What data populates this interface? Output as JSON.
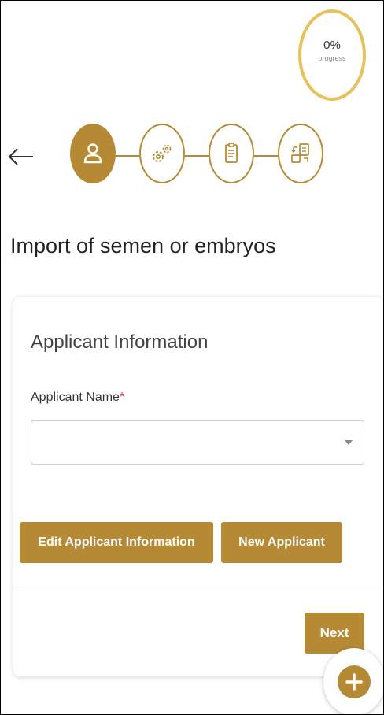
{
  "progress": {
    "value": "0%",
    "label": "progress",
    "fraction": 0
  },
  "nav": {
    "back_icon": "arrow-left-icon"
  },
  "stepper": {
    "active_index": 0,
    "steps": [
      {
        "icon": "user-icon"
      },
      {
        "icon": "gears-icon"
      },
      {
        "icon": "document-icon"
      },
      {
        "icon": "file-transfer-icon"
      }
    ]
  },
  "page": {
    "title": "Import of semen or embryos"
  },
  "applicant_section": {
    "title": "Applicant Information",
    "name_field": {
      "label": "Applicant Name",
      "required_mark": "*",
      "value": ""
    },
    "edit_button_label": "Edit Applicant Information",
    "new_button_label": "New Applicant"
  },
  "footer": {
    "next_label": "Next",
    "fab_icon": "plus-icon"
  },
  "colors": {
    "accent": "#b68a35",
    "progress_ring": "#e7c15c",
    "required": "#e0424a"
  }
}
